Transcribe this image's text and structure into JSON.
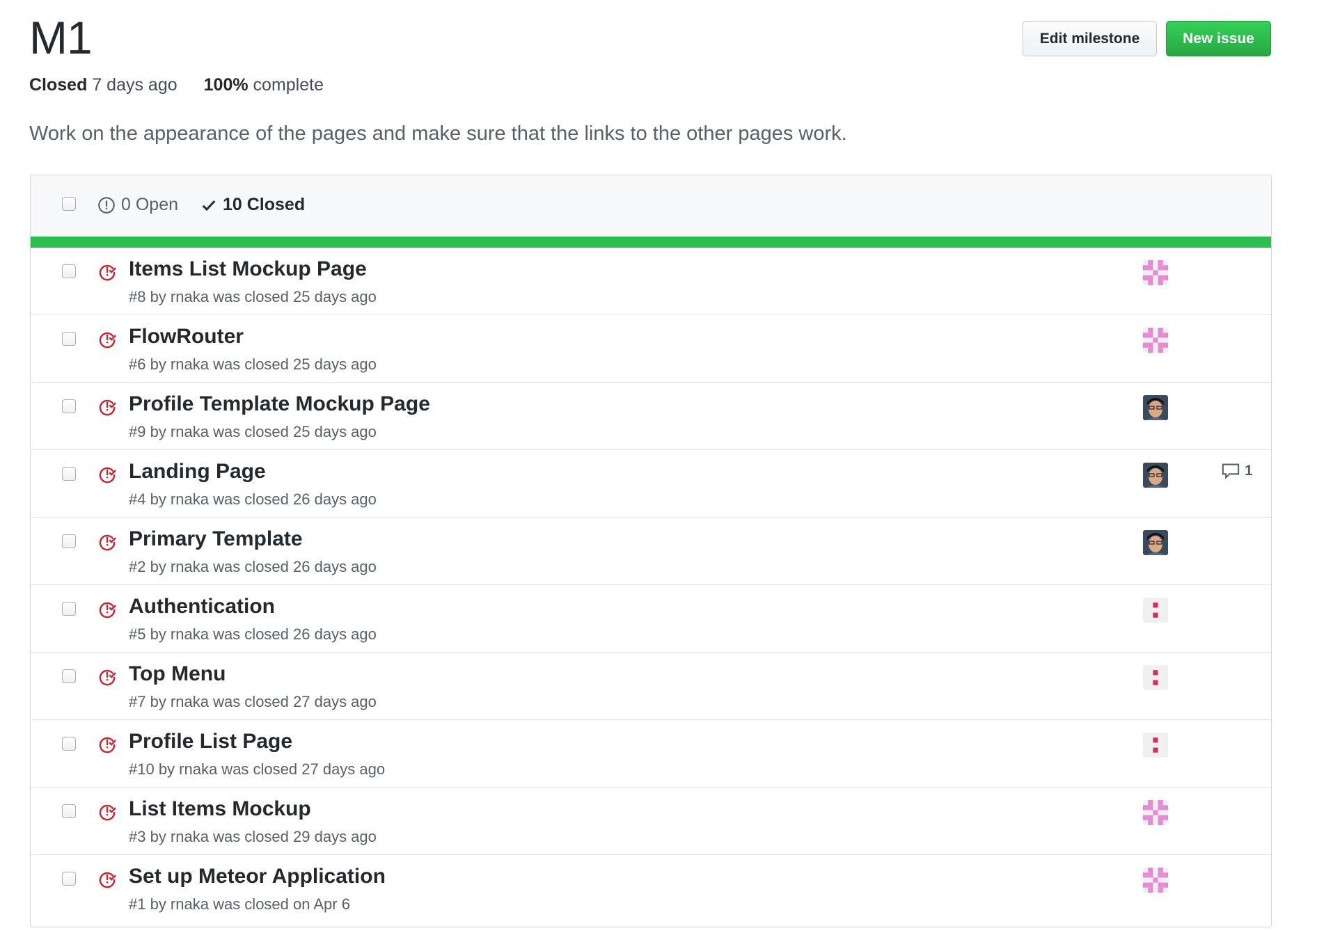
{
  "milestone": {
    "title": "M1",
    "status_label": "Closed",
    "status_time": "7 days ago",
    "progress_percent": "100%",
    "progress_suffix": "complete",
    "progress_fraction": 1.0,
    "description": "Work on the appearance of the pages and make sure that the links to the other pages work."
  },
  "toolbar": {
    "edit_label": "Edit milestone",
    "new_issue_label": "New issue"
  },
  "list_header": {
    "open_label": "0 Open",
    "closed_label": "10 Closed"
  },
  "colors": {
    "accent_green": "#2cbe4e",
    "closed_red": "#cb2431",
    "identicon_pink": "#e58ad4",
    "identicon_crimson": "#d1305e"
  },
  "issues": [
    {
      "title": "Items List Mockup Page",
      "subtitle": "#8 by rnaka was closed 25 days ago",
      "avatar": "identicon-pink",
      "comments": ""
    },
    {
      "title": "FlowRouter",
      "subtitle": "#6 by rnaka was closed 25 days ago",
      "avatar": "identicon-pink",
      "comments": ""
    },
    {
      "title": "Profile Template Mockup Page",
      "subtitle": "#9 by rnaka was closed 25 days ago",
      "avatar": "photo",
      "comments": ""
    },
    {
      "title": "Landing Page",
      "subtitle": "#4 by rnaka was closed 26 days ago",
      "avatar": "photo",
      "comments": "1"
    },
    {
      "title": "Primary Template",
      "subtitle": "#2 by rnaka was closed 26 days ago",
      "avatar": "photo",
      "comments": ""
    },
    {
      "title": "Authentication",
      "subtitle": "#5 by rnaka was closed 26 days ago",
      "avatar": "identicon-dots",
      "comments": ""
    },
    {
      "title": "Top Menu",
      "subtitle": "#7 by rnaka was closed 27 days ago",
      "avatar": "identicon-dots",
      "comments": ""
    },
    {
      "title": "Profile List Page",
      "subtitle": "#10 by rnaka was closed 27 days ago",
      "avatar": "identicon-dots",
      "comments": ""
    },
    {
      "title": "List Items Mockup",
      "subtitle": "#3 by rnaka was closed 29 days ago",
      "avatar": "identicon-pink",
      "comments": ""
    },
    {
      "title": "Set up Meteor Application",
      "subtitle": "#1 by rnaka was closed on Apr 6",
      "avatar": "identicon-pink",
      "comments": ""
    }
  ]
}
